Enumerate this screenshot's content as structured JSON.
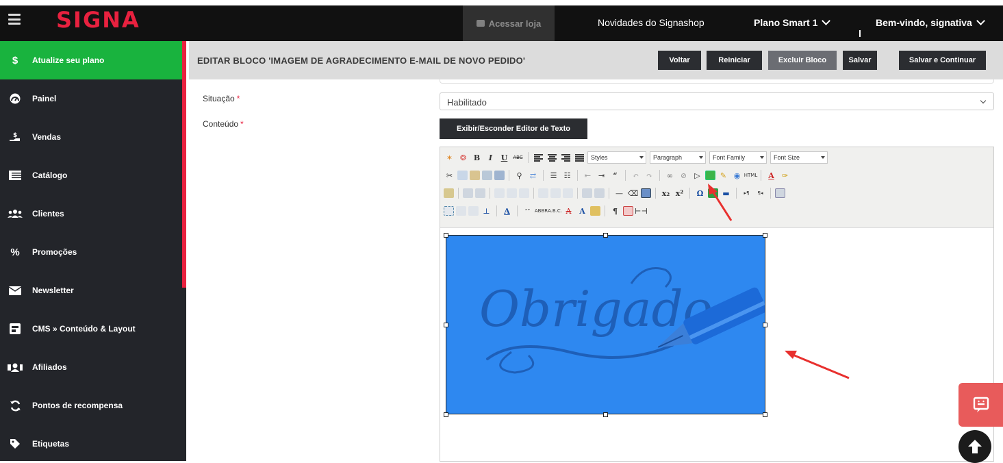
{
  "topbar": {
    "logo": "SIGNA",
    "store_button": "Acessar loja",
    "news_link": "Novidades do Signashop",
    "plan_link": "Plano Smart 1",
    "welcome_link": "Bem-vindo, signativa"
  },
  "sidebar": {
    "items": [
      {
        "label": "Atualize seu plano",
        "icon": "dollar-icon"
      },
      {
        "label": "Painel",
        "icon": "dashboard-icon"
      },
      {
        "label": "Vendas",
        "icon": "sales-icon"
      },
      {
        "label": "Catálogo",
        "icon": "list-icon"
      },
      {
        "label": "Clientes",
        "icon": "users-icon"
      },
      {
        "label": "Promoções",
        "icon": "percent-icon"
      },
      {
        "label": "Newsletter",
        "icon": "envelope-icon"
      },
      {
        "label": "CMS » Conteúdo & Layout",
        "icon": "layout-icon"
      },
      {
        "label": "Afiliados",
        "icon": "affiliates-icon"
      },
      {
        "label": "Pontos de recompensa",
        "icon": "refresh-icon"
      },
      {
        "label": "Etiquetas",
        "icon": "tag-icon"
      }
    ]
  },
  "header": {
    "title": "EDITAR BLOCO 'IMAGEM DE AGRADECIMENTO E-MAIL DE NOVO PEDIDO'",
    "buttons": {
      "back": "Voltar",
      "reset": "Reiniciar",
      "delete": "Excluir Bloco",
      "save": "Salvar",
      "save_continue": "Salvar e Continuar"
    }
  },
  "form": {
    "status_label": "Situação",
    "status_value": "Habilitado",
    "content_label": "Conteúdo",
    "required_mark": "*",
    "toggle_editor": "Exibir/Esconder Editor de Texto"
  },
  "editor": {
    "styles": "Styles",
    "paragraph": "Paragraph",
    "font_family": "Font Family",
    "font_size": "Font Size",
    "image_text": "Obrigado"
  },
  "colors": {
    "brand_red": "#e8213f",
    "active_green": "#19b33e",
    "image_blue": "#2e88f0"
  }
}
